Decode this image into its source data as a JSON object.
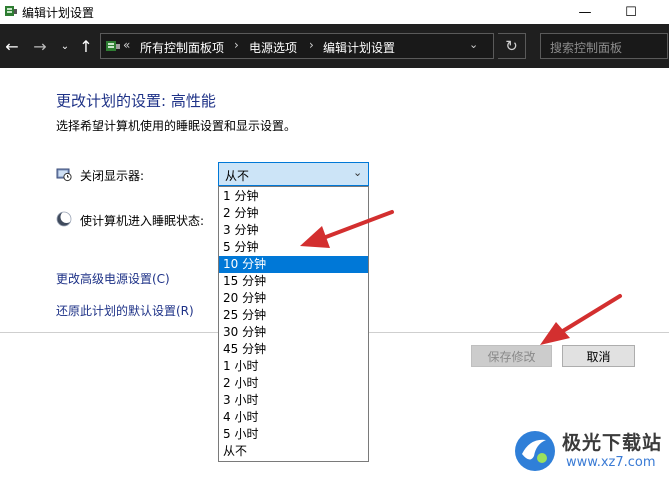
{
  "window": {
    "title": "编辑计划设置",
    "min_glyph": "—",
    "max_glyph": "☐"
  },
  "nav": {
    "back_glyph": "←",
    "forward_glyph": "→",
    "recent_glyph": "⌄",
    "up_glyph": "↑",
    "overflow_glyph": "«",
    "breadcrumb": [
      "所有控制面板项",
      "电源选项",
      "编辑计划设置"
    ],
    "separator": "›",
    "dropdown_glyph": "⌄",
    "refresh_glyph": "↻",
    "search_placeholder": "搜索控制面板"
  },
  "main": {
    "title": "更改计划的设置: 高性能",
    "subtitle": "选择希望计算机使用的睡眠设置和显示设置。",
    "settings": [
      {
        "label": "关闭显示器:",
        "icon": "monitor-clock-icon",
        "value": "从不"
      },
      {
        "label": "使计算机进入睡眠状态:",
        "icon": "moon-icon"
      }
    ],
    "links": [
      "更改高级电源设置(C)",
      "还原此计划的默认设置(R)"
    ],
    "save_label": "保存修改",
    "cancel_label": "取消"
  },
  "dropdown": {
    "options": [
      "1 分钟",
      "2 分钟",
      "3 分钟",
      "5 分钟",
      "10 分钟",
      "15 分钟",
      "20 分钟",
      "25 分钟",
      "30 分钟",
      "45 分钟",
      "1 小时",
      "2 小时",
      "3 小时",
      "4 小时",
      "5 小时",
      "从不"
    ],
    "selected_index": 4
  },
  "watermark": {
    "name": "极光下载站",
    "url": "www.xz7.com"
  },
  "colors": {
    "accent": "#0078d7",
    "link": "#1e3287",
    "arrow": "#d32f2f",
    "nav_bg": "#1f1f1f"
  }
}
